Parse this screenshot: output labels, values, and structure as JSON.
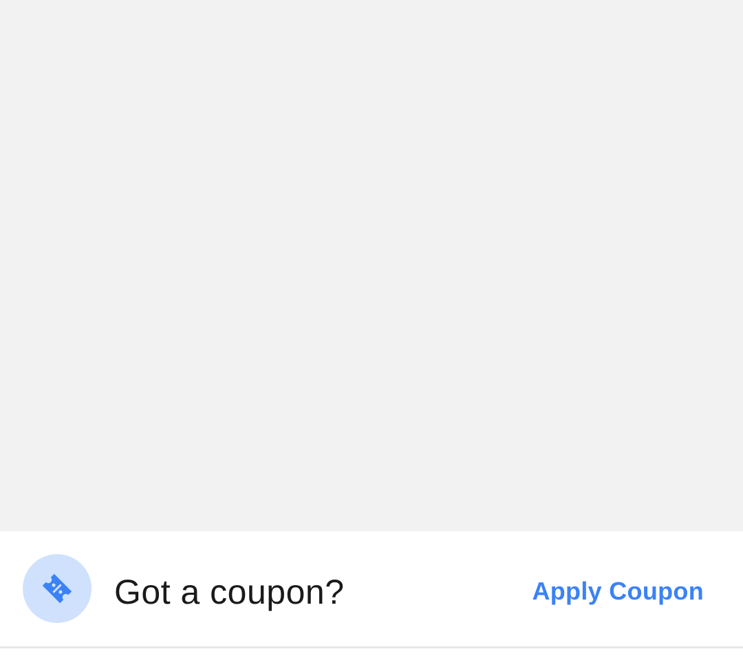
{
  "coupon": {
    "icon": "coupon-ticket-icon",
    "title": "Got a coupon?",
    "apply_label": "Apply Coupon"
  },
  "colors": {
    "background": "#f2f2f2",
    "panel": "#ffffff",
    "accent": "#3b82f6",
    "icon_circle": "#cfe1fd",
    "title_text": "#1a1a1a"
  }
}
